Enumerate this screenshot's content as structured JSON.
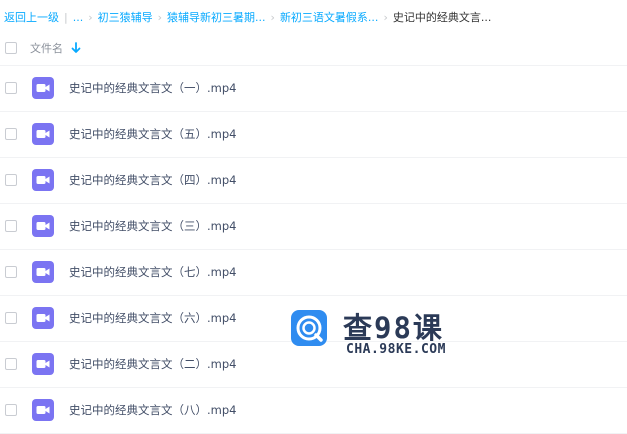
{
  "breadcrumb": {
    "back_label": "返回上一级",
    "ellipsis": "...",
    "items": [
      "初三猿辅导",
      "猿辅导新初三暑期...",
      "新初三语文暑假系..."
    ],
    "current": "史记中的经典文言..."
  },
  "header": {
    "column_label": "文件名",
    "sort_icon": "arrow-down-icon"
  },
  "files": [
    {
      "name": "史记中的经典文言文（一）.mp4",
      "icon": "video-file-icon"
    },
    {
      "name": "史记中的经典文言文（五）.mp4",
      "icon": "video-file-icon"
    },
    {
      "name": "史记中的经典文言文（四）.mp4",
      "icon": "video-file-icon"
    },
    {
      "name": "史记中的经典文言文（三）.mp4",
      "icon": "video-file-icon"
    },
    {
      "name": "史记中的经典文言文（七）.mp4",
      "icon": "video-file-icon"
    },
    {
      "name": "史记中的经典文言文（六）.mp4",
      "icon": "video-file-icon"
    },
    {
      "name": "史记中的经典文言文（二）.mp4",
      "icon": "video-file-icon"
    },
    {
      "name": "史记中的经典文言文（八）.mp4",
      "icon": "video-file-icon"
    }
  ],
  "watermark": {
    "title": "查98课",
    "url": "CHA.98KE.COM"
  },
  "colors": {
    "link": "#09aaff",
    "video_icon": "#7b74f2",
    "watermark_logo": "#2f8cf0"
  }
}
